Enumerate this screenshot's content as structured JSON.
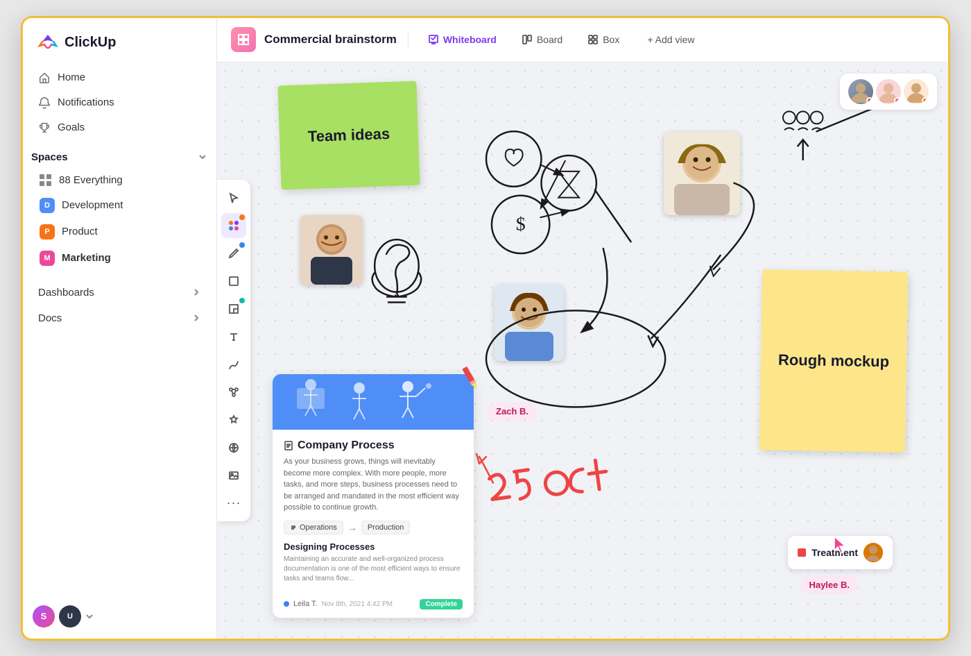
{
  "app": {
    "name": "ClickUp"
  },
  "sidebar": {
    "nav": [
      {
        "id": "home",
        "label": "Home",
        "icon": "home-icon"
      },
      {
        "id": "notifications",
        "label": "Notifications",
        "icon": "bell-icon"
      },
      {
        "id": "goals",
        "label": "Goals",
        "icon": "trophy-icon"
      }
    ],
    "spaces_label": "Spaces",
    "spaces": [
      {
        "id": "everything",
        "label": "Everything",
        "count": "88",
        "color": "",
        "letter": ""
      },
      {
        "id": "development",
        "label": "Development",
        "color": "#4f8ef7",
        "letter": "D"
      },
      {
        "id": "product",
        "label": "Product",
        "color": "#f97316",
        "letter": "P"
      },
      {
        "id": "marketing",
        "label": "Marketing",
        "color": "#ec4899",
        "letter": "M",
        "bold": true
      }
    ],
    "sections": [
      {
        "id": "dashboards",
        "label": "Dashboards"
      },
      {
        "id": "docs",
        "label": "Docs"
      }
    ],
    "bottom_users": [
      "S",
      "U"
    ]
  },
  "topbar": {
    "board_title": "Commercial brainstorm",
    "views": [
      {
        "id": "whiteboard",
        "label": "Whiteboard",
        "active": true,
        "icon": "whiteboard-icon"
      },
      {
        "id": "board",
        "label": "Board",
        "active": false,
        "icon": "board-icon"
      },
      {
        "id": "box",
        "label": "Box",
        "active": false,
        "icon": "box-icon"
      }
    ],
    "add_view_label": "+ Add view"
  },
  "whiteboard": {
    "sticky_green": {
      "text": "Team ideas"
    },
    "sticky_yellow": {
      "text": "Rough mockup"
    },
    "doc_card": {
      "title": "Company Process",
      "description": "As your business grows, things will inevitably become more complex. With more people, more tasks, and more steps, business processes need to be arranged and mandated in the most efficient way possible to continue growth.",
      "flow_from": "Operations",
      "flow_to": "Production",
      "section_title": "Designing Processes",
      "section_text": "Maintaining an accurate and well-organized process documentation is one of the most efficient ways to ensure tasks and teams flow...",
      "user": "Leila T.",
      "date": "Nov 8th, 2021 4:42 PM",
      "status": "Complete"
    },
    "treatment_label": "Treatment",
    "user_labels": {
      "zach": "Zach B.",
      "haylee": "Haylee B."
    },
    "oct_text": "25 oct"
  },
  "collab_avatars": [
    {
      "id": "avatar1",
      "dot_color": "red"
    },
    {
      "id": "avatar2",
      "dot_color": "pink"
    },
    {
      "id": "avatar3",
      "dot_color": "orange"
    }
  ]
}
